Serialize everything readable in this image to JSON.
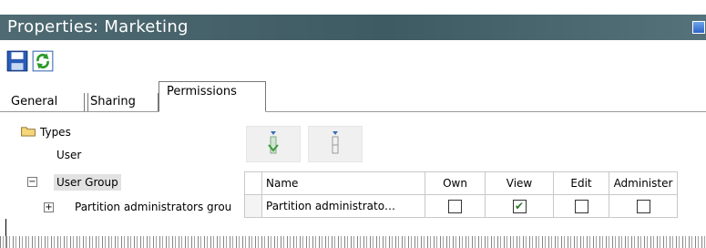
{
  "window": {
    "title": "Properties: Marketing"
  },
  "toolbar": {
    "save": "save-icon",
    "refresh": "refresh-icon"
  },
  "tabs": [
    {
      "label": "General"
    },
    {
      "label": "Sharing"
    },
    {
      "label": "Permissions"
    }
  ],
  "tree": {
    "types_label": "Types",
    "user_label": "User",
    "user_group_label": "User Group",
    "user_group_expander": "−",
    "partition_label": "Partition administrators grou",
    "partition_expander": "+"
  },
  "role_buttons": [
    "add-permission-icon",
    "remove-permission-icon"
  ],
  "grid": {
    "headers": [
      "Name",
      "Own",
      "View",
      "Edit",
      "Administer"
    ],
    "rows": [
      {
        "name": "Partition administrato…",
        "own": false,
        "view": true,
        "edit": false,
        "administer": false
      }
    ],
    "checked_mark": "✔"
  },
  "colors": {
    "titlebar": "#4f6a72",
    "selection": "#e2e2e2"
  }
}
